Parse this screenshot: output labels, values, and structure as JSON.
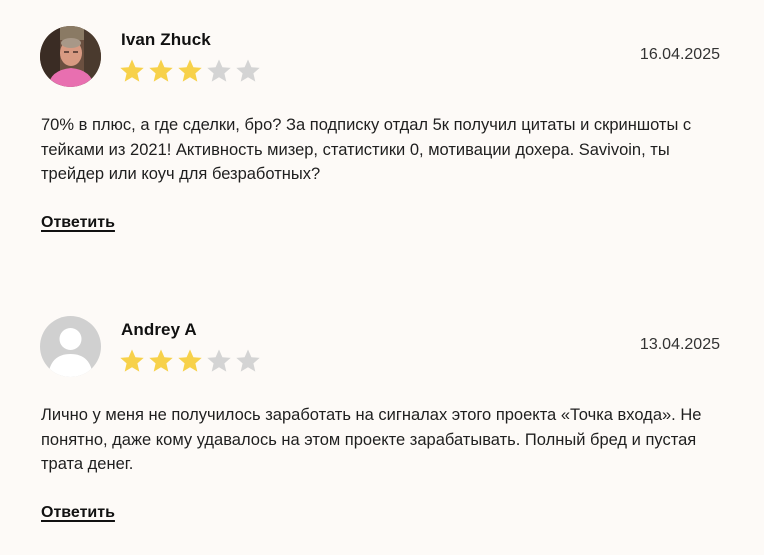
{
  "colors": {
    "star_filled": "#f7d14a",
    "star_empty": "#d4d4d4",
    "background": "#fdfaf7"
  },
  "reviews": [
    {
      "author": "Ivan Zhuck",
      "avatar": "photo-avatar",
      "rating": 3,
      "max_rating": 5,
      "date": "16.04.2025",
      "text": "70% в плюс, а где сделки, бро? За подписку отдал 5к получил цитаты и скриншоты с тейками из 2021! Активность мизер, статистики 0, мотивации дохера. Savivoin, ты трейдер или коуч для безработных?",
      "reply_label": "Ответить"
    },
    {
      "author": "Andrey A",
      "avatar": "default-user-avatar",
      "rating": 3,
      "max_rating": 5,
      "date": "13.04.2025",
      "text": "Лично у меня не получилось заработать на сигналах этого проекта «Точка входа». Не понятно, даже кому удавалось на этом проекте зарабатывать. Полный бред и пустая трата денег.",
      "reply_label": "Ответить"
    }
  ]
}
